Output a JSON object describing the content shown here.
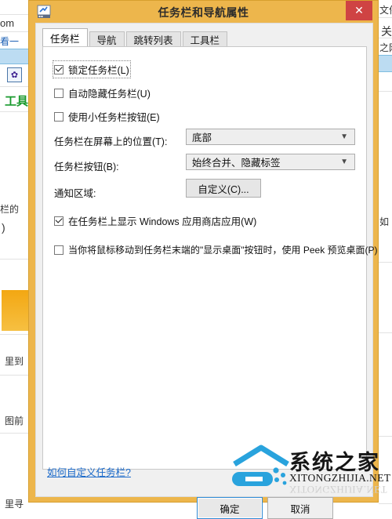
{
  "window": {
    "title": "任务栏和导航属性",
    "icon": "taskbar-properties-icon",
    "close_label": "✕"
  },
  "tabs": [
    {
      "label": "任务栏",
      "active": true
    },
    {
      "label": "导航",
      "active": false
    },
    {
      "label": "跳转列表",
      "active": false
    },
    {
      "label": "工具栏",
      "active": false,
      "highlighted": true
    }
  ],
  "taskbar_page": {
    "checkboxes": [
      {
        "label": "锁定任务栏(L)",
        "checked": true,
        "focused": true
      },
      {
        "label": "自动隐藏任务栏(U)",
        "checked": false,
        "focused": false
      },
      {
        "label": "使用小任务栏按钮(E)",
        "checked": false,
        "focused": false
      }
    ],
    "fields": [
      {
        "label": "任务栏在屏幕上的位置(T):",
        "value": "底部",
        "type": "combobox"
      },
      {
        "label": "任务栏按钮(B):",
        "value": "始终合并、隐藏标签",
        "type": "combobox"
      }
    ],
    "notification_area": {
      "label": "通知区域:",
      "button_label": "自定义(C)..."
    },
    "checkboxes_bottom": [
      {
        "label": "在任务栏上显示 Windows 应用商店应用(W)",
        "checked": true
      },
      {
        "label": "当你将鼠标移动到任务栏末端的\"显示桌面\"按钮时，使用 Peek 预览桌面(P)",
        "checked": false
      }
    ],
    "help_link": "如何自定义任务栏?"
  },
  "dialog_buttons": {
    "ok": "确定",
    "cancel": "取消"
  },
  "watermark": {
    "cn": "系统之家",
    "en": "XITONGZHIJIA.NET"
  },
  "background": {
    "left_texts": [
      "om",
      "看一",
      "工具",
      "栏的",
      ")",
      "里到",
      "图前",
      "里寻"
    ],
    "right_texts": [
      "文件",
      "关",
      "之网",
      "如"
    ],
    "paw_icon": "paw-icon"
  },
  "colors": {
    "frame": "#edb64c",
    "close": "#cf4343",
    "highlight": "#ff0000",
    "link": "#1a69c9",
    "focus": "#2f8ad4"
  }
}
